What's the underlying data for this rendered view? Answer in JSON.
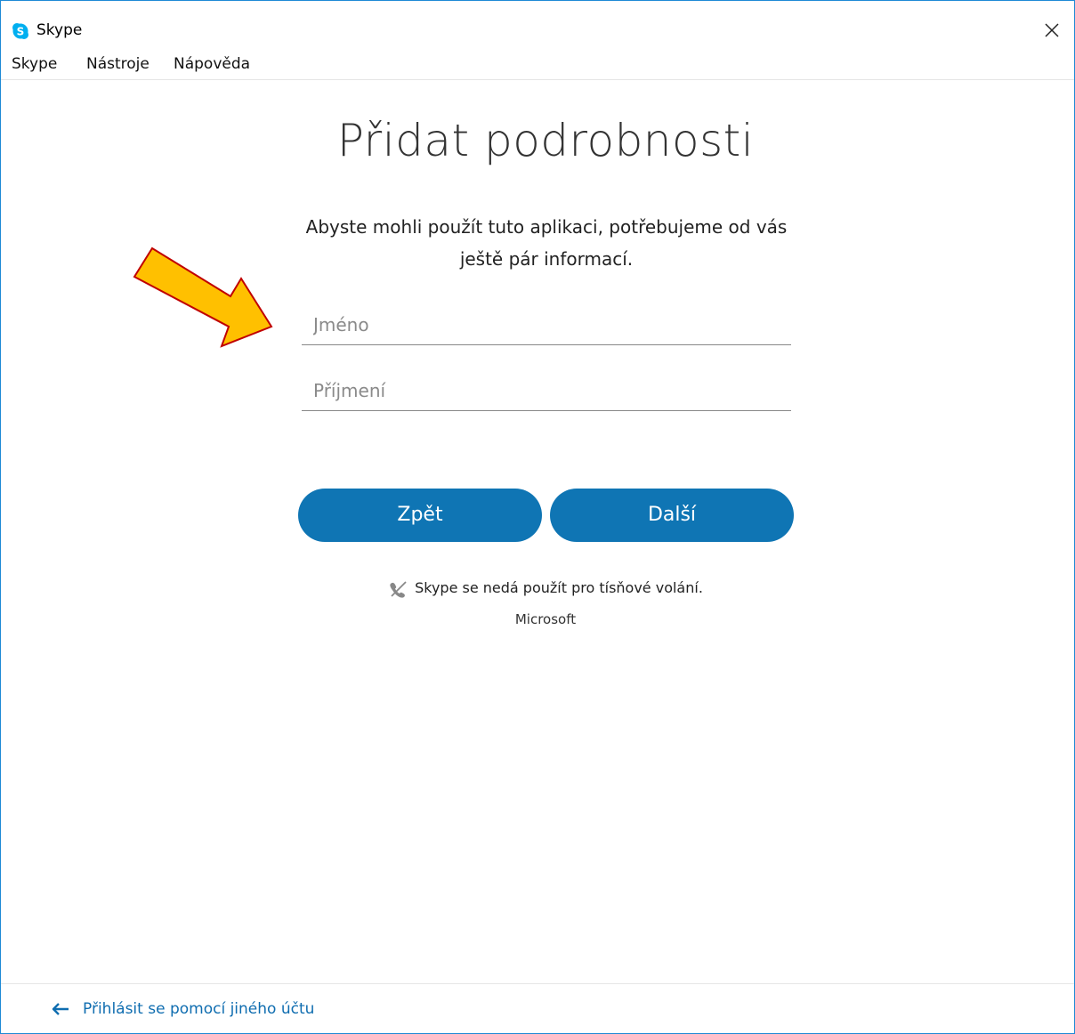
{
  "window": {
    "title": "Skype",
    "close_icon": "close-icon",
    "logo_icon": "skype-logo-icon"
  },
  "menu": {
    "items": [
      "Skype",
      "Nástroje",
      "Nápověda"
    ]
  },
  "main": {
    "heading": "Přidat podrobnosti",
    "subtitle": "Abyste mohli použít tuto aplikaci, potřebujeme od vás ještě pár informací.",
    "first_name": {
      "placeholder": "Jméno",
      "value": ""
    },
    "last_name": {
      "placeholder": "Příjmení",
      "value": ""
    },
    "back_label": "Zpět",
    "next_label": "Další",
    "emergency_note": "Skype se nedá použít pro tísňové volání.",
    "company": "Microsoft"
  },
  "footer": {
    "link_label": "Přihlásit se pomocí jiného účtu",
    "link_icon": "arrow-left-icon"
  },
  "colors": {
    "accent": "#0f75b4",
    "link": "#0f6db0",
    "annotation_fill": "#ffc000",
    "annotation_stroke": "#c00000",
    "window_border": "#1e8ad6"
  }
}
